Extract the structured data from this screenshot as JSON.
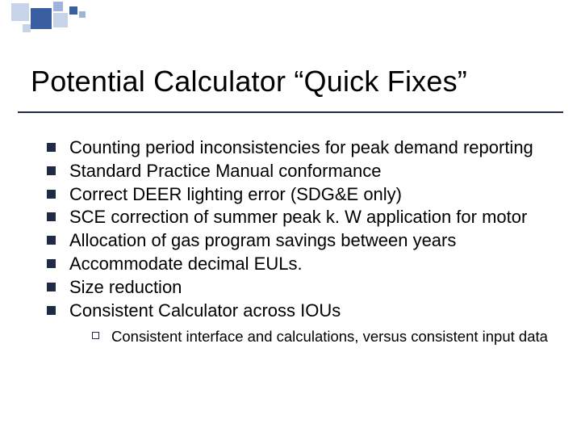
{
  "title": "Potential Calculator “Quick Fixes”",
  "bullets": [
    {
      "text": "Counting period inconsistencies for peak demand reporting"
    },
    {
      "text": "Standard Practice Manual conformance"
    },
    {
      "text": "Correct DEER lighting error (SDG&E only)"
    },
    {
      "text": "SCE correction of summer peak k. W application for motor"
    },
    {
      "text": "Allocation of gas program savings between years"
    },
    {
      "text": "Accommodate decimal EULs."
    },
    {
      "text": "Size reduction"
    },
    {
      "text": "Consistent Calculator across IOUs",
      "sub": [
        {
          "text": "Consistent interface and calculations, versus consistent input data"
        }
      ]
    }
  ]
}
